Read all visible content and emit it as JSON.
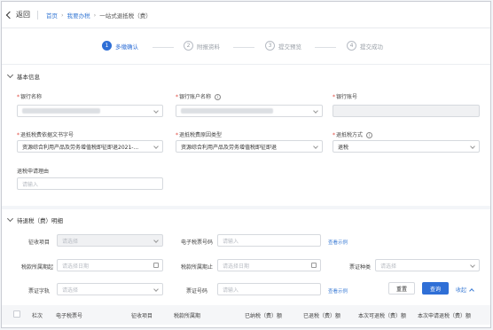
{
  "topbar": {
    "back_label": "返回",
    "breadcrumb": [
      "首页",
      "我要办税",
      "一站式退抵税（费）"
    ],
    "breadcrumb_sep": "›"
  },
  "steps": [
    {
      "num": "1",
      "label": "多缴确认",
      "active": true
    },
    {
      "num": "2",
      "label": "附报资料",
      "active": false
    },
    {
      "num": "3",
      "label": "提交预览",
      "active": false
    },
    {
      "num": "4",
      "label": "提交成功",
      "active": false
    }
  ],
  "basic": {
    "title": "基本信息",
    "bank_name_label": "银行名称",
    "bank_account_name_label": "银行账户名称",
    "bank_account_no_label": "银行账号",
    "refund_doc_label": "退抵税费依据文书字号",
    "refund_doc_value": "资源综合利用产品及劳务增值税即征即退2021-...",
    "refund_reason_label": "退抵税费原因类型",
    "refund_reason_value": "资源综合利用产品及劳务增值税即征即退",
    "refund_method_label": "退抵税方式",
    "refund_method_value": "退税",
    "reason_label": "退税申请理由",
    "reason_placeholder": "请输入"
  },
  "detail": {
    "title": "待退税（费）明细",
    "levy_item_label": "征收项目",
    "levy_item_placeholder": "请选择",
    "e_ticket_label": "电子税票号码",
    "e_ticket_placeholder": "请输入",
    "view_example": "查看示例",
    "period_start_label": "税款所属期起",
    "period_start_placeholder": "请选择日期",
    "period_end_label": "税款所属期止",
    "period_end_placeholder": "请选择日期",
    "voucher_type_label": "票证种类",
    "voucher_type_placeholder": "请选择",
    "voucher_char_label": "票证字轨",
    "voucher_char_placeholder": "请选择",
    "voucher_no_label": "票证号码",
    "voucher_no_placeholder": "请输入",
    "view_example2": "查看示例",
    "reset": "重置",
    "query": "查询",
    "collapse": "收起"
  },
  "table": {
    "headers": [
      "栏次",
      "电子税票号",
      "征收项目",
      "税款所属期",
      "已纳税（费）额",
      "已退税（费）额",
      "本次可退税（费）额",
      "本次申请退税（费）额"
    ]
  },
  "colors": {
    "accent": "#2f6fd6",
    "required": "#e0473d",
    "link": "#3a7bd5"
  }
}
